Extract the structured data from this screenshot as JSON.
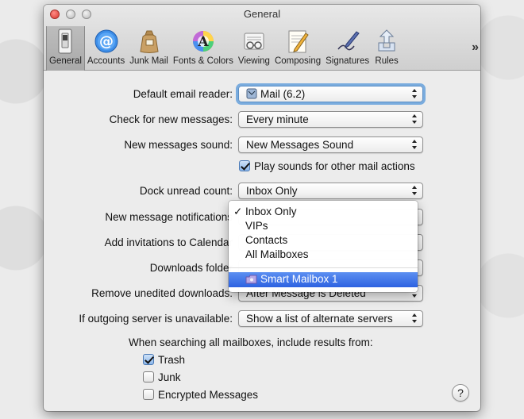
{
  "window": {
    "title": "General"
  },
  "toolbar": {
    "tabs": [
      {
        "label": "General",
        "icon": "general-switch-icon",
        "selected": true
      },
      {
        "label": "Accounts",
        "icon": "at-sign-icon",
        "selected": false
      },
      {
        "label": "Junk Mail",
        "icon": "junk-mail-bag-icon",
        "selected": false
      },
      {
        "label": "Fonts & Colors",
        "icon": "fonts-colors-icon",
        "selected": false
      },
      {
        "label": "Viewing",
        "icon": "viewing-glasses-icon",
        "selected": false
      },
      {
        "label": "Composing",
        "icon": "composing-pencil-icon",
        "selected": false
      },
      {
        "label": "Signatures",
        "icon": "signature-pen-icon",
        "selected": false
      },
      {
        "label": "Rules",
        "icon": "rules-arrows-icon",
        "selected": false
      }
    ],
    "more_glyph": "»"
  },
  "settings": {
    "default_reader": {
      "label": "Default email reader:",
      "value": "Mail (6.2)"
    },
    "check_messages": {
      "label": "Check for new messages:",
      "value": "Every minute"
    },
    "new_sound": {
      "label": "New messages sound:",
      "value": "New Messages Sound"
    },
    "play_sounds": {
      "label": "Play sounds for other mail actions",
      "checked": true
    },
    "dock_unread": {
      "label": "Dock unread count:",
      "value": "Inbox Only"
    },
    "notifications": {
      "label": "New message notifications"
    },
    "invitations": {
      "label": "Add invitations to Calendar"
    },
    "downloads_folder": {
      "label": "Downloads folder"
    },
    "remove_downloads": {
      "label": "Remove unedited downloads:",
      "value": "After Message is Deleted"
    },
    "outgoing_server": {
      "label": "If outgoing server is unavailable:",
      "value": "Show a list of alternate servers"
    },
    "search_section": {
      "label": "When searching all mailboxes, include results from:",
      "options": [
        {
          "label": "Trash",
          "checked": true
        },
        {
          "label": "Junk",
          "checked": false
        },
        {
          "label": "Encrypted Messages",
          "checked": false
        }
      ]
    }
  },
  "notifications_menu": {
    "check_glyph": "✓",
    "items": [
      {
        "label": "Inbox Only",
        "checked": true
      },
      {
        "label": "VIPs",
        "checked": false
      },
      {
        "label": "Contacts",
        "checked": false
      },
      {
        "label": "All Mailboxes",
        "checked": false
      }
    ],
    "smart_mailbox": {
      "label": "Smart Mailbox 1",
      "highlighted": true,
      "icon": "smart-mailbox-icon"
    }
  },
  "help": {
    "glyph": "?"
  },
  "colors": {
    "focus_ring": "#7aacde",
    "menu_highlight": "#2d62e1"
  }
}
